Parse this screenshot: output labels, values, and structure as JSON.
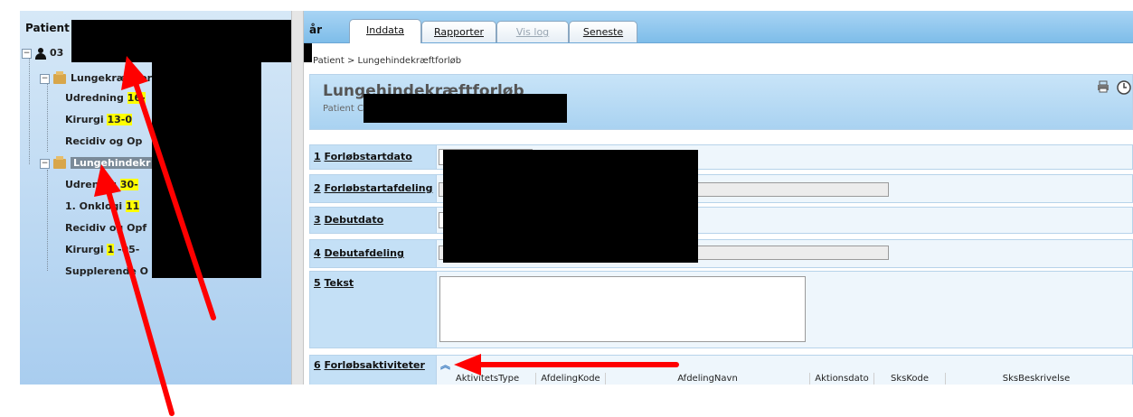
{
  "sidebar": {
    "title": "Patient",
    "patient_id": "03",
    "items": [
      {
        "label": "Lungekræftfor",
        "highlight": "",
        "level": 1
      },
      {
        "label": "Udredning ",
        "highlight": "16-",
        "level": 2
      },
      {
        "label": "Kirurgi ",
        "highlight": "13-0",
        "level": 2
      },
      {
        "label": "Recidiv og Op",
        "highlight": "",
        "level": 2
      },
      {
        "label": "Lungehindekr",
        "highlight": "",
        "level": 1
      },
      {
        "label": "Udre",
        "highlight": "",
        "suffix": "ning ",
        "highlight2": "30-",
        "level": 2
      },
      {
        "label": "1. Onk",
        "highlight": "",
        "suffix": "logi ",
        "highlight2": "11",
        "level": 2
      },
      {
        "label": "Recidiv",
        "highlight": "",
        "suffix": " og Opf",
        "level": 2
      },
      {
        "label": "Kirurgi ",
        "highlight": "1",
        "suffix": " -05-",
        "level": 2
      },
      {
        "label": "Supplerende O",
        "highlight": "",
        "level": 2
      }
    ]
  },
  "tabbar": {
    "prefix": "år",
    "tabs": [
      {
        "label": "Inddata",
        "state": "active"
      },
      {
        "label": "Rapporter",
        "state": "normal"
      },
      {
        "label": "Vis log",
        "state": "disabled"
      },
      {
        "label": "Seneste",
        "state": "normal"
      }
    ]
  },
  "breadcrumb": "Patient > Lungehindekræftforløb",
  "header": {
    "title": "Lungehindekræftforløb",
    "subtitle": "Patient C",
    "print_icon": "print-icon",
    "clock_icon": "clock-icon"
  },
  "fields": [
    {
      "number": "1",
      "label": "Forløbstartdato"
    },
    {
      "number": "2",
      "label": "Forløbstartafdeling"
    },
    {
      "number": "3",
      "label": "Debutdato"
    },
    {
      "number": "4",
      "label": "Debutafdeling"
    },
    {
      "number": "5",
      "label": "Tekst"
    },
    {
      "number": "6",
      "label": "Forløbsaktiviteter"
    }
  ],
  "activities_table": {
    "columns": [
      "AktivitetsType",
      "AfdelingKode",
      "AfdelingNavn",
      "Aktionsdato",
      "SksKode",
      "SksBeskrivelse"
    ]
  },
  "colors": {
    "highlight": "#ffff00",
    "annotation_arrow": "#ff0000",
    "tab_bar": "#7ebde9"
  }
}
